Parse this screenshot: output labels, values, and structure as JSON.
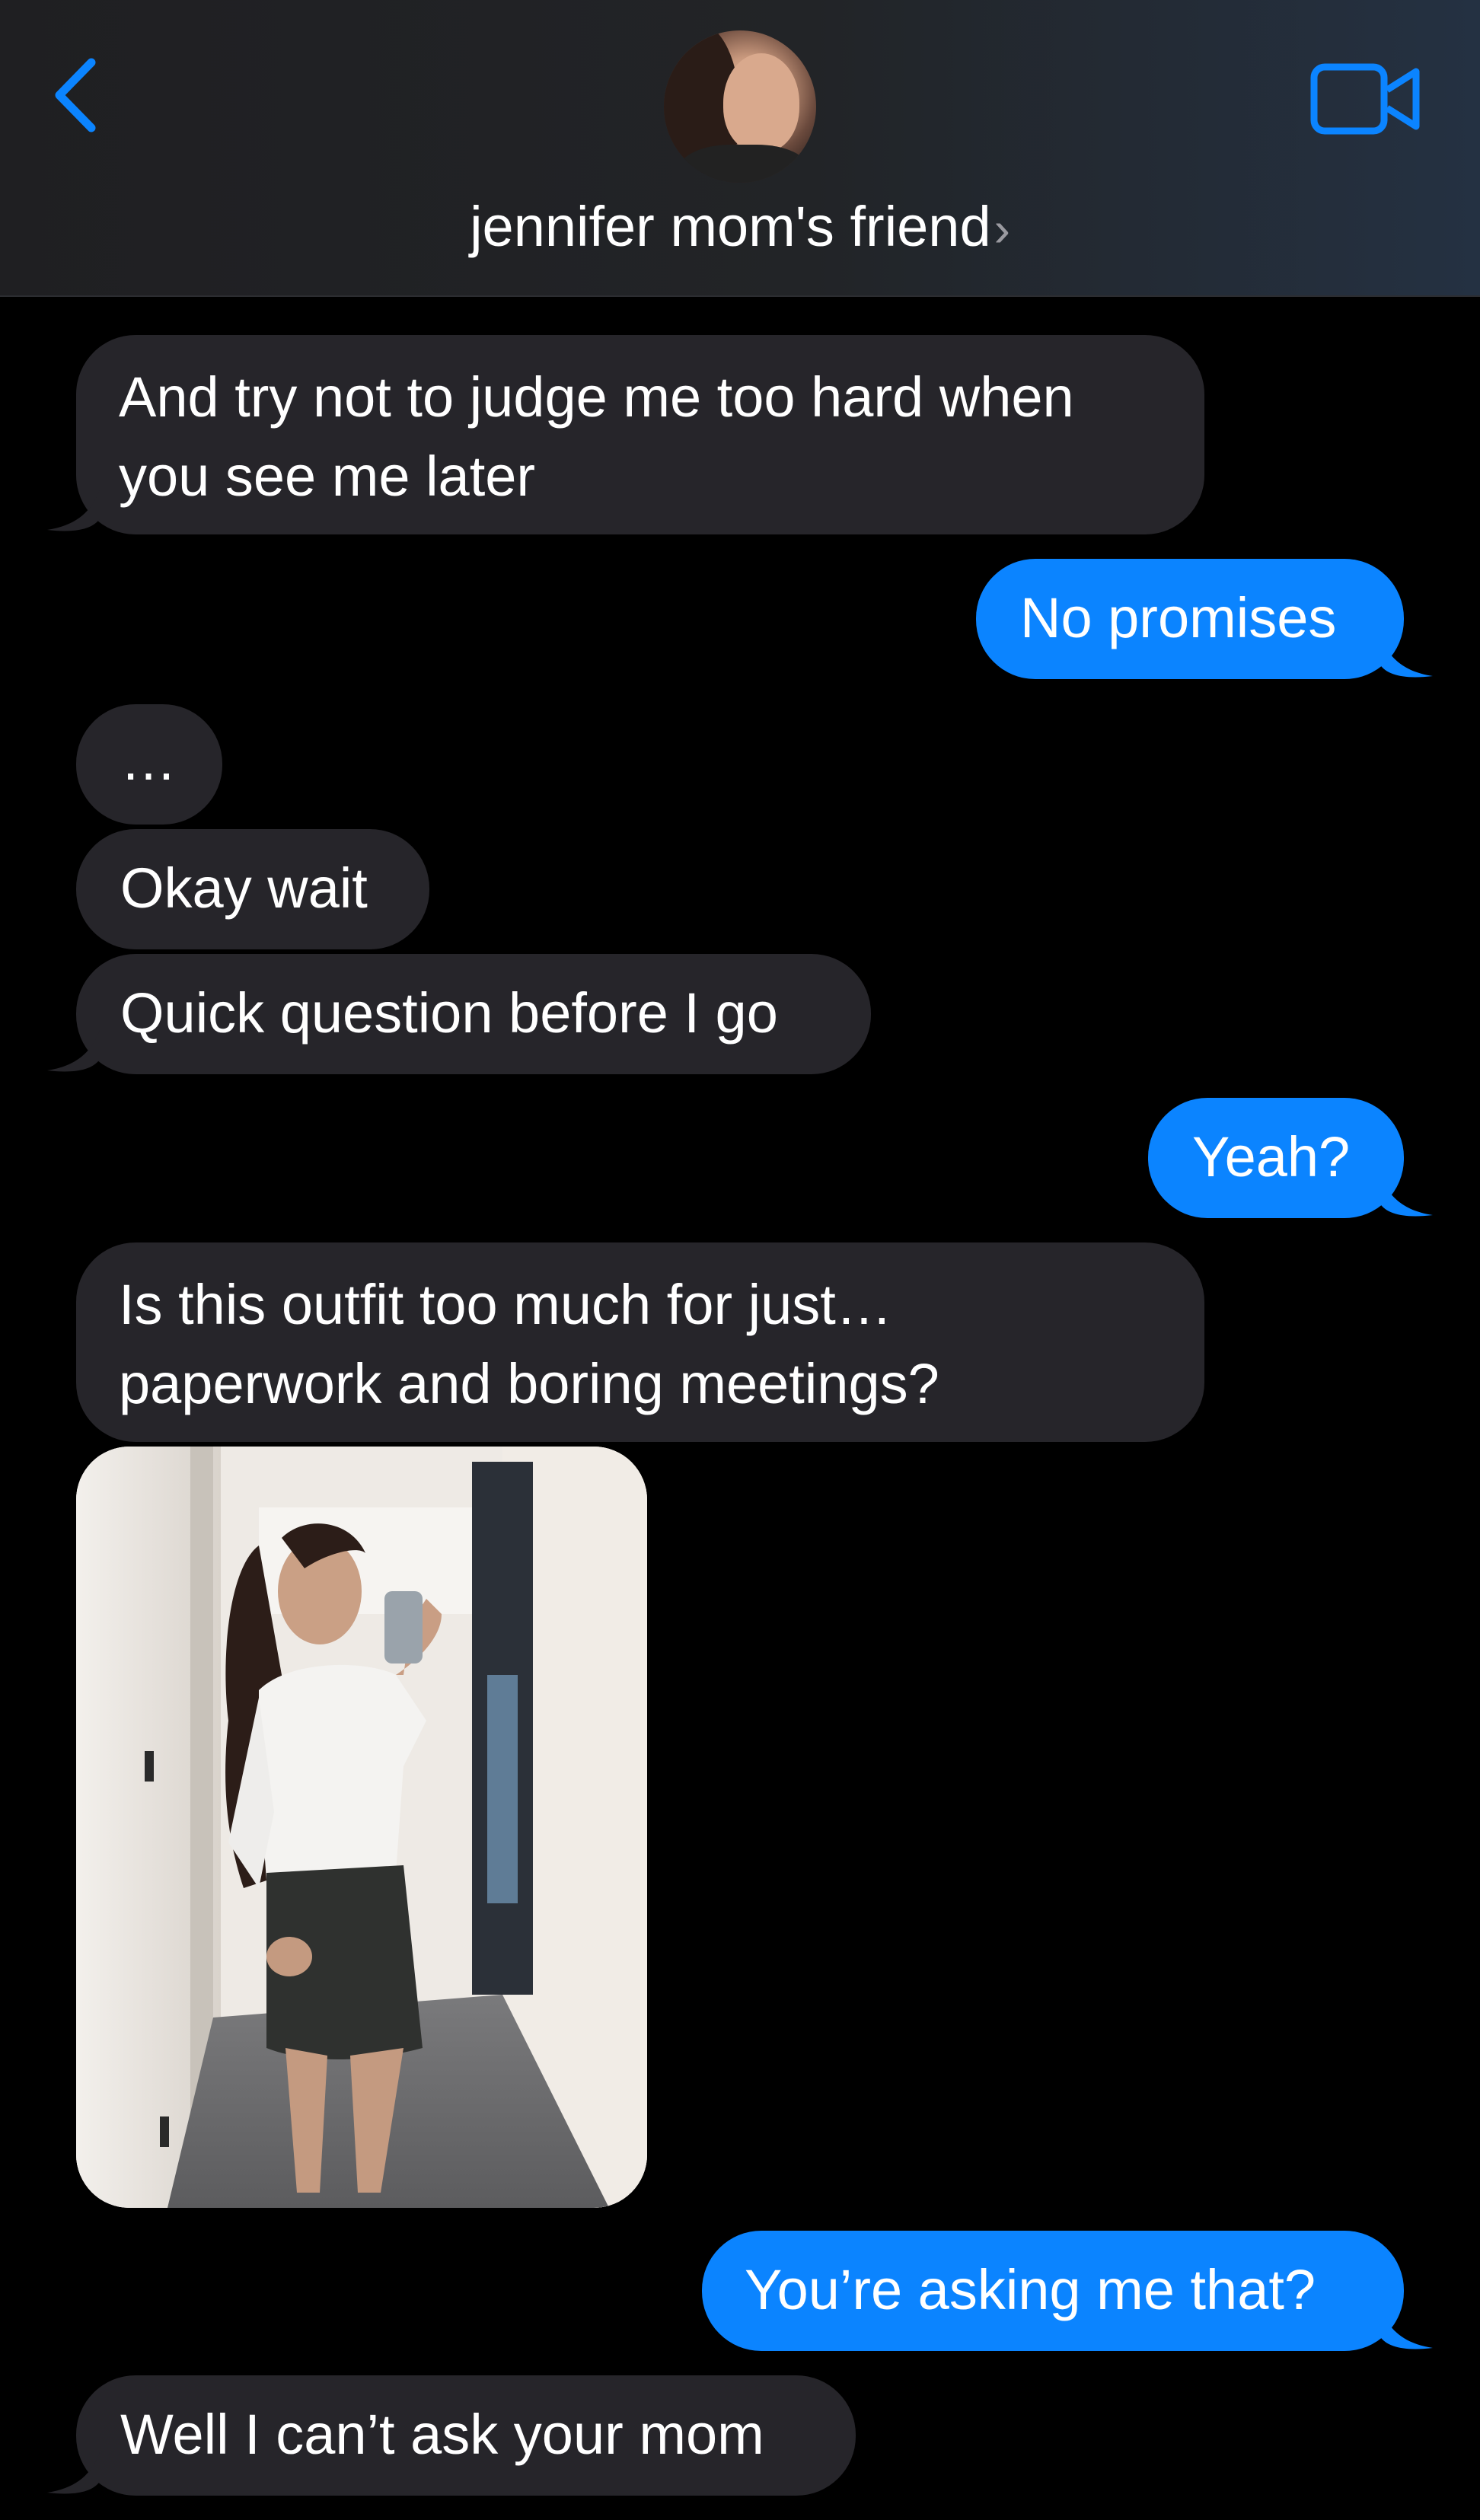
{
  "header": {
    "contact_name": "jennifer mom's friend",
    "chevron": "›",
    "back_icon": "chevron-left-icon",
    "video_icon": "video-camera-icon",
    "accent_color": "#0b84ff"
  },
  "colors": {
    "incoming_bubble": "#26252a",
    "outgoing_bubble": "#0b84ff",
    "background": "#000000"
  },
  "messages": [
    {
      "direction": "incoming",
      "text": "And try not to judge me too hard when you see me later"
    },
    {
      "direction": "outgoing",
      "text": "No promises"
    },
    {
      "direction": "incoming",
      "text": "…"
    },
    {
      "direction": "incoming",
      "text": "Okay wait"
    },
    {
      "direction": "incoming",
      "text": "Quick question before I go"
    },
    {
      "direction": "outgoing",
      "text": "Yeah?"
    },
    {
      "direction": "incoming",
      "text": "Is this outfit too much for just… paperwork and boring meetings?"
    },
    {
      "direction": "incoming",
      "type": "photo"
    },
    {
      "direction": "outgoing",
      "text": "You’re asking me that?"
    },
    {
      "direction": "incoming",
      "text": "Well I can’t ask your mom"
    }
  ]
}
